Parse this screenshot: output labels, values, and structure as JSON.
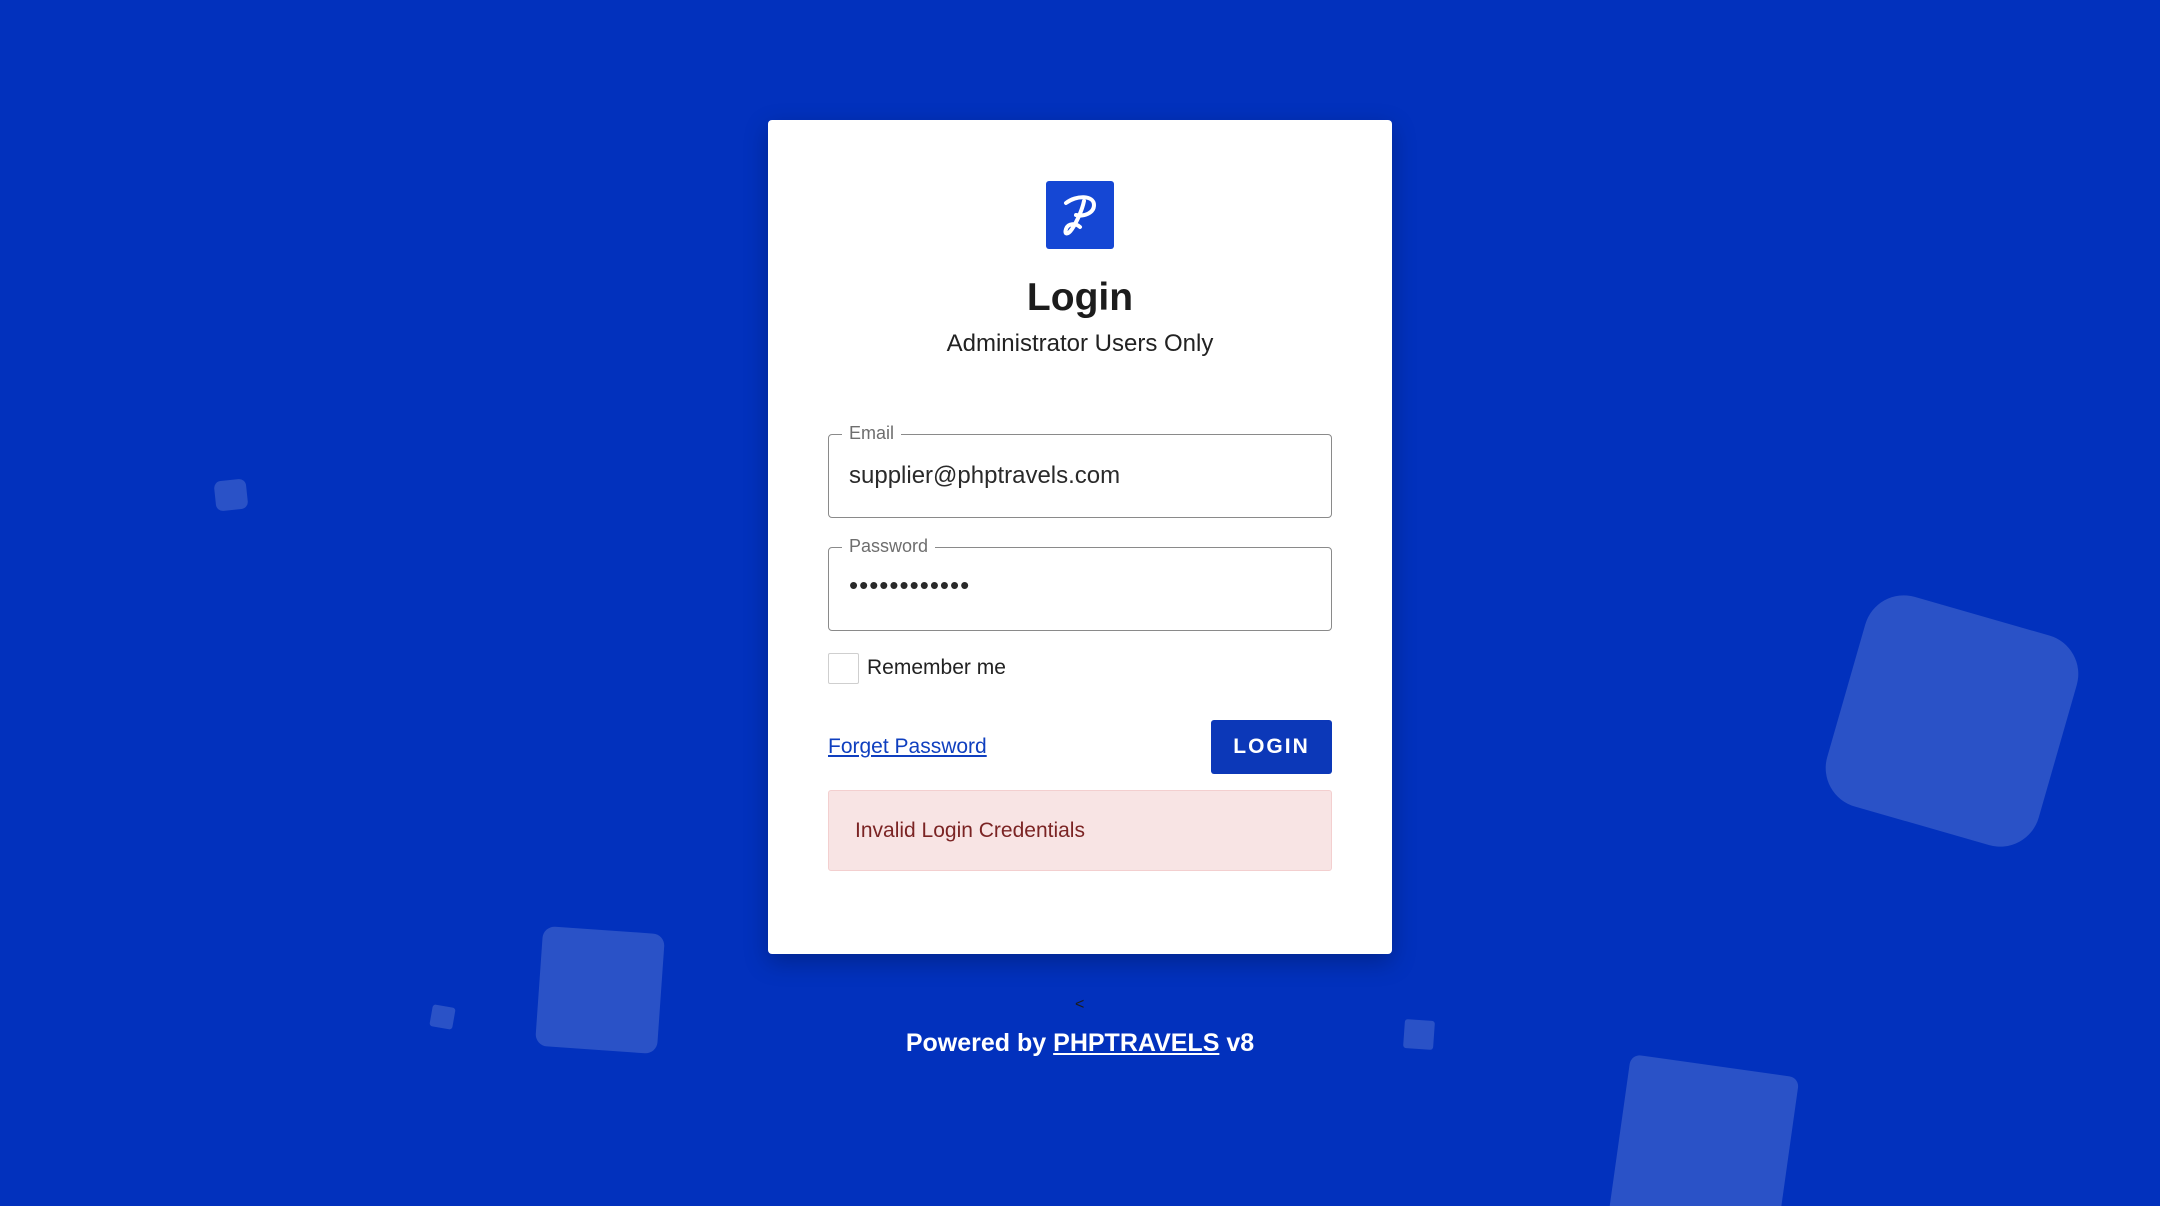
{
  "colors": {
    "background": "#0231bd",
    "accent": "#0c38b8",
    "logo": "#1547d4",
    "error_bg": "#f8e4e4",
    "error_text": "#7b2424"
  },
  "logo": {
    "icon": "phptravels-logo-icon"
  },
  "login": {
    "title": "Login",
    "subtitle": "Administrator Users Only",
    "email": {
      "label": "Email",
      "value": "supplier@phptravels.com"
    },
    "password": {
      "label": "Password",
      "value": "••••••••••••"
    },
    "remember_me": {
      "label": "Remember me",
      "checked": false
    },
    "forget_password": "Forget Password",
    "login_button": "LOGIN",
    "error_message": "Invalid Login Credentials"
  },
  "small_marker": "<",
  "footer": {
    "prefix": "Powered by",
    "brand": "PHPTRAVELS",
    "version": "v8"
  }
}
